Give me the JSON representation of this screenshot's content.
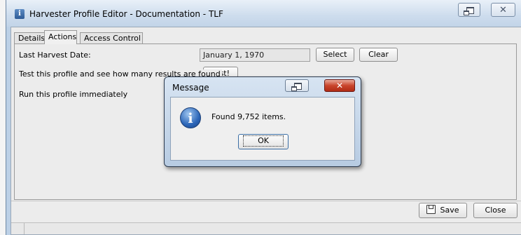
{
  "window": {
    "title": "Harvester Profile Editor - Documentation - TLF",
    "app_icon_glyph": "i",
    "close_glyph": "✕"
  },
  "tabs": [
    {
      "label": "Details",
      "active": false
    },
    {
      "label": "Actions",
      "active": true
    },
    {
      "label": "Access Control",
      "active": false
    }
  ],
  "actions": {
    "last_harvest_label": "Last Harvest Date:",
    "last_harvest_value": "January 1, 1970",
    "select_label": "Select",
    "clear_label": "Clear",
    "test_label": "Test this profile and see how many results are found",
    "test_button": "Test!",
    "run_label": "Run this profile immediately"
  },
  "footer": {
    "save_label": "Save",
    "close_label": "Close"
  },
  "dialog": {
    "title": "Message",
    "message": "Found 9,752 items.",
    "ok_label": "OK",
    "icon": "info-icon",
    "icon_glyph": "i",
    "close_glyph": "✕"
  },
  "colors": {
    "title_bar": "#cddced",
    "dialog_close": "#c9452c",
    "info_icon": "#2c66b8"
  }
}
